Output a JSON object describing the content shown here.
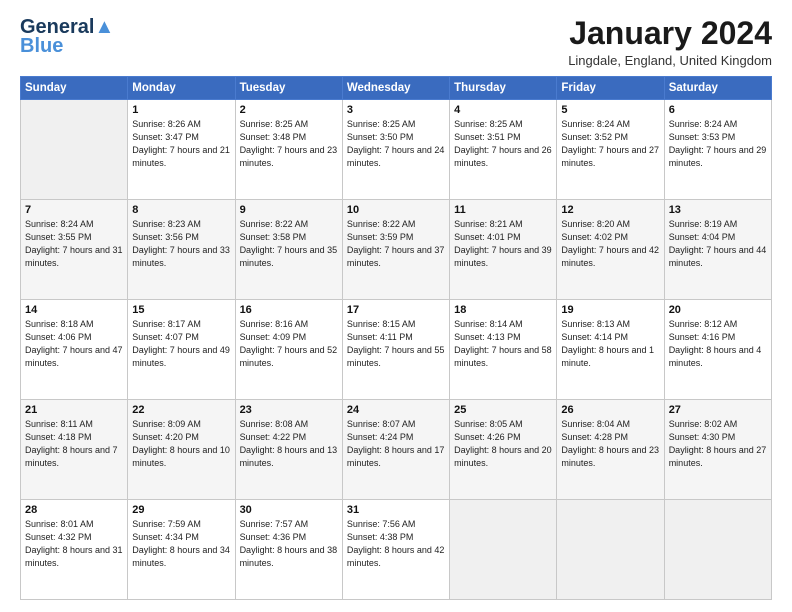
{
  "header": {
    "logo_line1": "General",
    "logo_line2": "Blue",
    "month_title": "January 2024",
    "location": "Lingdale, England, United Kingdom"
  },
  "weekdays": [
    "Sunday",
    "Monday",
    "Tuesday",
    "Wednesday",
    "Thursday",
    "Friday",
    "Saturday"
  ],
  "weeks": [
    [
      {
        "day": "",
        "empty": true
      },
      {
        "day": "1",
        "sunrise": "Sunrise: 8:26 AM",
        "sunset": "Sunset: 3:47 PM",
        "daylight": "Daylight: 7 hours and 21 minutes."
      },
      {
        "day": "2",
        "sunrise": "Sunrise: 8:25 AM",
        "sunset": "Sunset: 3:48 PM",
        "daylight": "Daylight: 7 hours and 23 minutes."
      },
      {
        "day": "3",
        "sunrise": "Sunrise: 8:25 AM",
        "sunset": "Sunset: 3:50 PM",
        "daylight": "Daylight: 7 hours and 24 minutes."
      },
      {
        "day": "4",
        "sunrise": "Sunrise: 8:25 AM",
        "sunset": "Sunset: 3:51 PM",
        "daylight": "Daylight: 7 hours and 26 minutes."
      },
      {
        "day": "5",
        "sunrise": "Sunrise: 8:24 AM",
        "sunset": "Sunset: 3:52 PM",
        "daylight": "Daylight: 7 hours and 27 minutes."
      },
      {
        "day": "6",
        "sunrise": "Sunrise: 8:24 AM",
        "sunset": "Sunset: 3:53 PM",
        "daylight": "Daylight: 7 hours and 29 minutes."
      }
    ],
    [
      {
        "day": "7",
        "sunrise": "Sunrise: 8:24 AM",
        "sunset": "Sunset: 3:55 PM",
        "daylight": "Daylight: 7 hours and 31 minutes."
      },
      {
        "day": "8",
        "sunrise": "Sunrise: 8:23 AM",
        "sunset": "Sunset: 3:56 PM",
        "daylight": "Daylight: 7 hours and 33 minutes."
      },
      {
        "day": "9",
        "sunrise": "Sunrise: 8:22 AM",
        "sunset": "Sunset: 3:58 PM",
        "daylight": "Daylight: 7 hours and 35 minutes."
      },
      {
        "day": "10",
        "sunrise": "Sunrise: 8:22 AM",
        "sunset": "Sunset: 3:59 PM",
        "daylight": "Daylight: 7 hours and 37 minutes."
      },
      {
        "day": "11",
        "sunrise": "Sunrise: 8:21 AM",
        "sunset": "Sunset: 4:01 PM",
        "daylight": "Daylight: 7 hours and 39 minutes."
      },
      {
        "day": "12",
        "sunrise": "Sunrise: 8:20 AM",
        "sunset": "Sunset: 4:02 PM",
        "daylight": "Daylight: 7 hours and 42 minutes."
      },
      {
        "day": "13",
        "sunrise": "Sunrise: 8:19 AM",
        "sunset": "Sunset: 4:04 PM",
        "daylight": "Daylight: 7 hours and 44 minutes."
      }
    ],
    [
      {
        "day": "14",
        "sunrise": "Sunrise: 8:18 AM",
        "sunset": "Sunset: 4:06 PM",
        "daylight": "Daylight: 7 hours and 47 minutes."
      },
      {
        "day": "15",
        "sunrise": "Sunrise: 8:17 AM",
        "sunset": "Sunset: 4:07 PM",
        "daylight": "Daylight: 7 hours and 49 minutes."
      },
      {
        "day": "16",
        "sunrise": "Sunrise: 8:16 AM",
        "sunset": "Sunset: 4:09 PM",
        "daylight": "Daylight: 7 hours and 52 minutes."
      },
      {
        "day": "17",
        "sunrise": "Sunrise: 8:15 AM",
        "sunset": "Sunset: 4:11 PM",
        "daylight": "Daylight: 7 hours and 55 minutes."
      },
      {
        "day": "18",
        "sunrise": "Sunrise: 8:14 AM",
        "sunset": "Sunset: 4:13 PM",
        "daylight": "Daylight: 7 hours and 58 minutes."
      },
      {
        "day": "19",
        "sunrise": "Sunrise: 8:13 AM",
        "sunset": "Sunset: 4:14 PM",
        "daylight": "Daylight: 8 hours and 1 minute."
      },
      {
        "day": "20",
        "sunrise": "Sunrise: 8:12 AM",
        "sunset": "Sunset: 4:16 PM",
        "daylight": "Daylight: 8 hours and 4 minutes."
      }
    ],
    [
      {
        "day": "21",
        "sunrise": "Sunrise: 8:11 AM",
        "sunset": "Sunset: 4:18 PM",
        "daylight": "Daylight: 8 hours and 7 minutes."
      },
      {
        "day": "22",
        "sunrise": "Sunrise: 8:09 AM",
        "sunset": "Sunset: 4:20 PM",
        "daylight": "Daylight: 8 hours and 10 minutes."
      },
      {
        "day": "23",
        "sunrise": "Sunrise: 8:08 AM",
        "sunset": "Sunset: 4:22 PM",
        "daylight": "Daylight: 8 hours and 13 minutes."
      },
      {
        "day": "24",
        "sunrise": "Sunrise: 8:07 AM",
        "sunset": "Sunset: 4:24 PM",
        "daylight": "Daylight: 8 hours and 17 minutes."
      },
      {
        "day": "25",
        "sunrise": "Sunrise: 8:05 AM",
        "sunset": "Sunset: 4:26 PM",
        "daylight": "Daylight: 8 hours and 20 minutes."
      },
      {
        "day": "26",
        "sunrise": "Sunrise: 8:04 AM",
        "sunset": "Sunset: 4:28 PM",
        "daylight": "Daylight: 8 hours and 23 minutes."
      },
      {
        "day": "27",
        "sunrise": "Sunrise: 8:02 AM",
        "sunset": "Sunset: 4:30 PM",
        "daylight": "Daylight: 8 hours and 27 minutes."
      }
    ],
    [
      {
        "day": "28",
        "sunrise": "Sunrise: 8:01 AM",
        "sunset": "Sunset: 4:32 PM",
        "daylight": "Daylight: 8 hours and 31 minutes."
      },
      {
        "day": "29",
        "sunrise": "Sunrise: 7:59 AM",
        "sunset": "Sunset: 4:34 PM",
        "daylight": "Daylight: 8 hours and 34 minutes."
      },
      {
        "day": "30",
        "sunrise": "Sunrise: 7:57 AM",
        "sunset": "Sunset: 4:36 PM",
        "daylight": "Daylight: 8 hours and 38 minutes."
      },
      {
        "day": "31",
        "sunrise": "Sunrise: 7:56 AM",
        "sunset": "Sunset: 4:38 PM",
        "daylight": "Daylight: 8 hours and 42 minutes."
      },
      {
        "day": "",
        "empty": true
      },
      {
        "day": "",
        "empty": true
      },
      {
        "day": "",
        "empty": true
      }
    ]
  ]
}
